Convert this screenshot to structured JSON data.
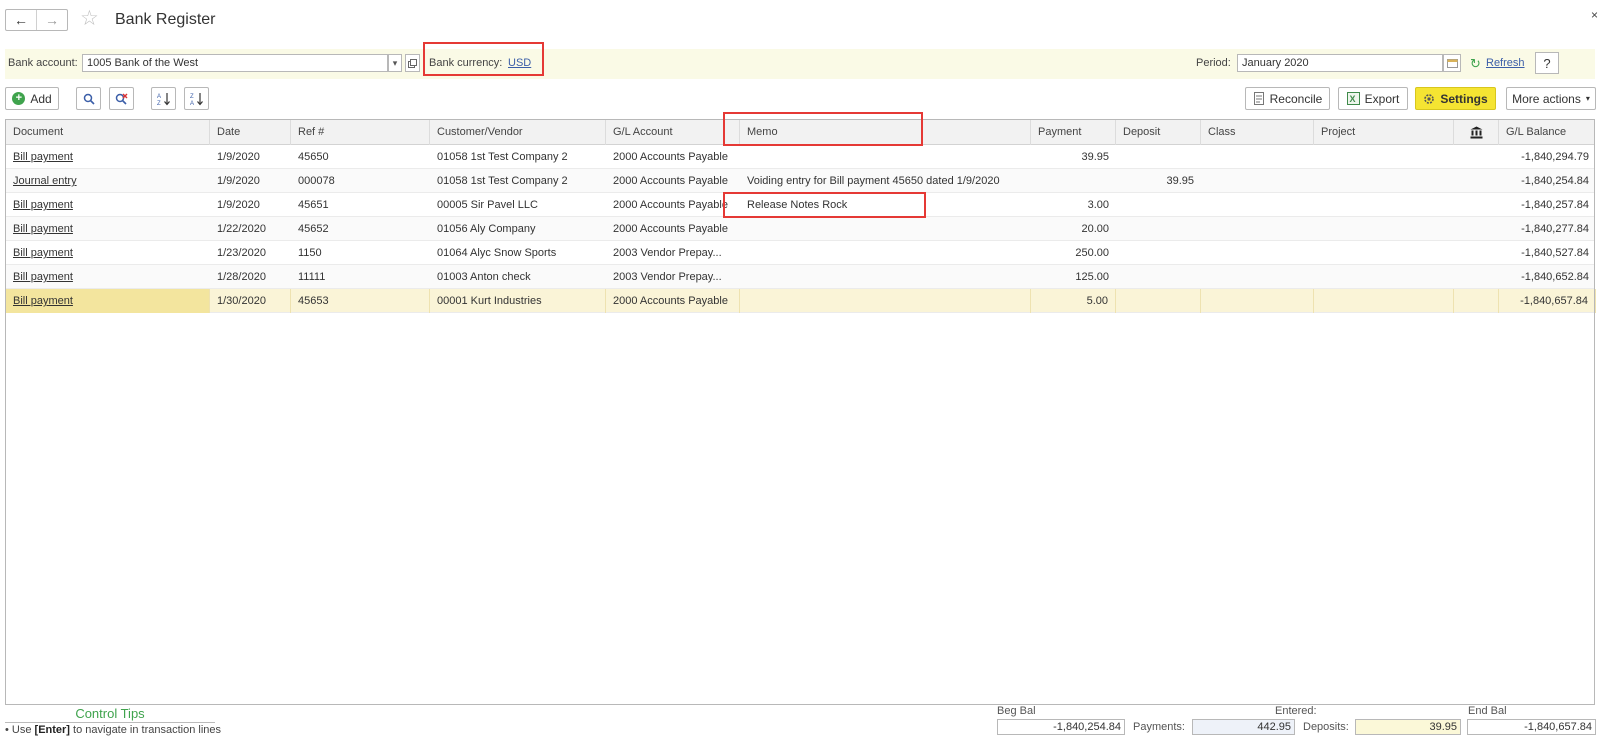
{
  "title_bar": {
    "title": "Bank Register",
    "back_symbol": "←",
    "forward_symbol": "→",
    "favorite_symbol": "☆",
    "close_symbol": "×"
  },
  "filter": {
    "bank_account_label": "Bank account:",
    "bank_account_value": "1005 Bank of the West",
    "currency_label": "Bank currency:",
    "currency_value": "USD",
    "period_label": "Period:",
    "period_value": "January 2020",
    "refresh_label": "Refresh",
    "help_label": "?"
  },
  "toolbar": {
    "add_label": "Add",
    "reconcile_label": "Reconcile",
    "export_label": "Export",
    "settings_label": "Settings",
    "more_actions_label": "More actions"
  },
  "grid": {
    "columns": [
      "Document",
      "Date",
      "Ref #",
      "Customer/Vendor",
      "G/L Account",
      "Memo",
      "Payment",
      "Deposit",
      "Class",
      "Project",
      "",
      "G/L Balance"
    ],
    "rows": [
      {
        "document": "Bill payment",
        "date": "1/9/2020",
        "ref": "45650",
        "vendor": "01058 1st Test Company 2",
        "gl_account": "2000 Accounts Payable",
        "memo": "",
        "payment": "39.95",
        "deposit": "",
        "gl_balance": "-1,840,294.79"
      },
      {
        "document": "Journal entry",
        "date": "1/9/2020",
        "ref": "000078",
        "vendor": "01058 1st Test Company 2",
        "gl_account": "2000 Accounts Payable",
        "memo": "Voiding entry for Bill payment 45650 dated 1/9/2020",
        "payment": "",
        "deposit": "39.95",
        "gl_balance": "-1,840,254.84"
      },
      {
        "document": "Bill payment",
        "date": "1/9/2020",
        "ref": "45651",
        "vendor": "00005 Sir Pavel LLC",
        "gl_account": "2000 Accounts Payable",
        "memo": "Release Notes Rock",
        "payment": "3.00",
        "deposit": "",
        "gl_balance": "-1,840,257.84"
      },
      {
        "document": "Bill payment",
        "date": "1/22/2020",
        "ref": "45652",
        "vendor": "01056 Aly Company",
        "gl_account": "2000 Accounts Payable",
        "memo": "",
        "payment": "20.00",
        "deposit": "",
        "gl_balance": "-1,840,277.84"
      },
      {
        "document": "Bill payment",
        "date": "1/23/2020",
        "ref": "1150",
        "vendor": "01064 Alyc Snow Sports",
        "gl_account": "2003 Vendor Prepay...",
        "memo": "",
        "payment": "250.00",
        "deposit": "",
        "gl_balance": "-1,840,527.84"
      },
      {
        "document": "Bill payment",
        "date": "1/28/2020",
        "ref": "11111",
        "vendor": "01003 Anton check",
        "gl_account": "2003 Vendor Prepay...",
        "memo": "",
        "payment": "125.00",
        "deposit": "",
        "gl_balance": "-1,840,652.84"
      },
      {
        "document": "Bill payment",
        "date": "1/30/2020",
        "ref": "45653",
        "vendor": "00001 Kurt Industries",
        "gl_account": "2000 Accounts Payable",
        "memo": "",
        "payment": "5.00",
        "deposit": "",
        "gl_balance": "-1,840,657.84"
      }
    ]
  },
  "footer": {
    "tips_title": "Control Tips",
    "tip_prefix": "• Use ",
    "tip_key": "[Enter]",
    "tip_suffix": " to navigate in transaction lines",
    "beg_bal_label": "Beg Bal",
    "beg_bal_value": "-1,840,254.84",
    "entered_label": "Entered:",
    "payments_label": "Payments:",
    "payments_value": "442.95",
    "deposits_label": "Deposits:",
    "deposits_value": "39.95",
    "end_bal_label": "End Bal",
    "end_bal_value": "-1,840,657.84"
  },
  "colors": {
    "highlight_border": "#e53935",
    "settings_button": "#f5e432",
    "selected_row": "#faf4d7",
    "tips_title": "#3fa34d",
    "link": "#3b5ea8"
  },
  "icons": [
    "back-arrow-icon",
    "forward-arrow-icon",
    "star-icon",
    "open-icon",
    "calendar-icon",
    "refresh-icon",
    "plus-icon",
    "find-icon",
    "clear-find-icon",
    "sort-asc-icon",
    "sort-desc-icon",
    "reconcile-icon",
    "export-icon",
    "gear-icon",
    "bank-icon"
  ]
}
